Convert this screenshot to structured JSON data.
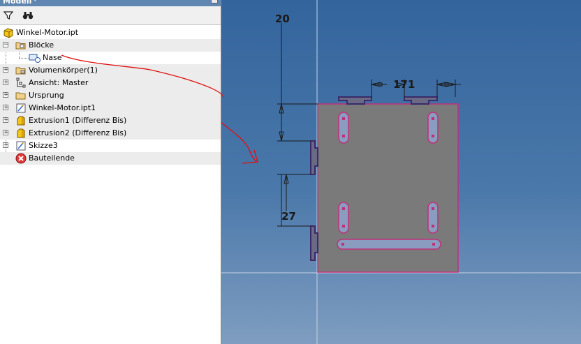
{
  "panel": {
    "title": "Modell",
    "dropdown_glyph": "▾"
  },
  "toolbar": {
    "filter_icon": "filter-icon",
    "search_icon": "binoculars-icon"
  },
  "tree": {
    "items": [
      {
        "label": "Winkel-Motor.ipt",
        "icon": "part-icon"
      },
      {
        "label": "Blöcke",
        "icon": "folder-open-icon",
        "expander": "−"
      },
      {
        "label": "Nase",
        "icon": "block-icon"
      },
      {
        "label": "Volumenkörper(1)",
        "icon": "folder-icon",
        "expander": "+"
      },
      {
        "label": "Ansicht: Master",
        "icon": "view-icon",
        "expander": "+"
      },
      {
        "label": "Ursprung",
        "icon": "folder-icon",
        "expander": "+"
      },
      {
        "label": "Winkel-Motor.ipt1",
        "icon": "sketch-icon",
        "expander": "+"
      },
      {
        "label": "Extrusion1 (Differenz Bis)",
        "icon": "extrusion-icon",
        "expander": "+"
      },
      {
        "label": "Extrusion2 (Differenz Bis)",
        "icon": "extrusion-icon",
        "expander": "+"
      },
      {
        "label": "Skizze3",
        "icon": "sketch-icon",
        "expander": "+"
      },
      {
        "label": "Bauteilende",
        "icon": "end-of-part-icon"
      }
    ]
  },
  "drawing": {
    "dim_top": "20",
    "dim_width": "171",
    "dim_side": "27"
  },
  "colors": {
    "part_fill": "#7a7a7a",
    "part_edge": "#c0307a",
    "block_edge": "#3a2a6a",
    "annotation": "#e01010"
  }
}
